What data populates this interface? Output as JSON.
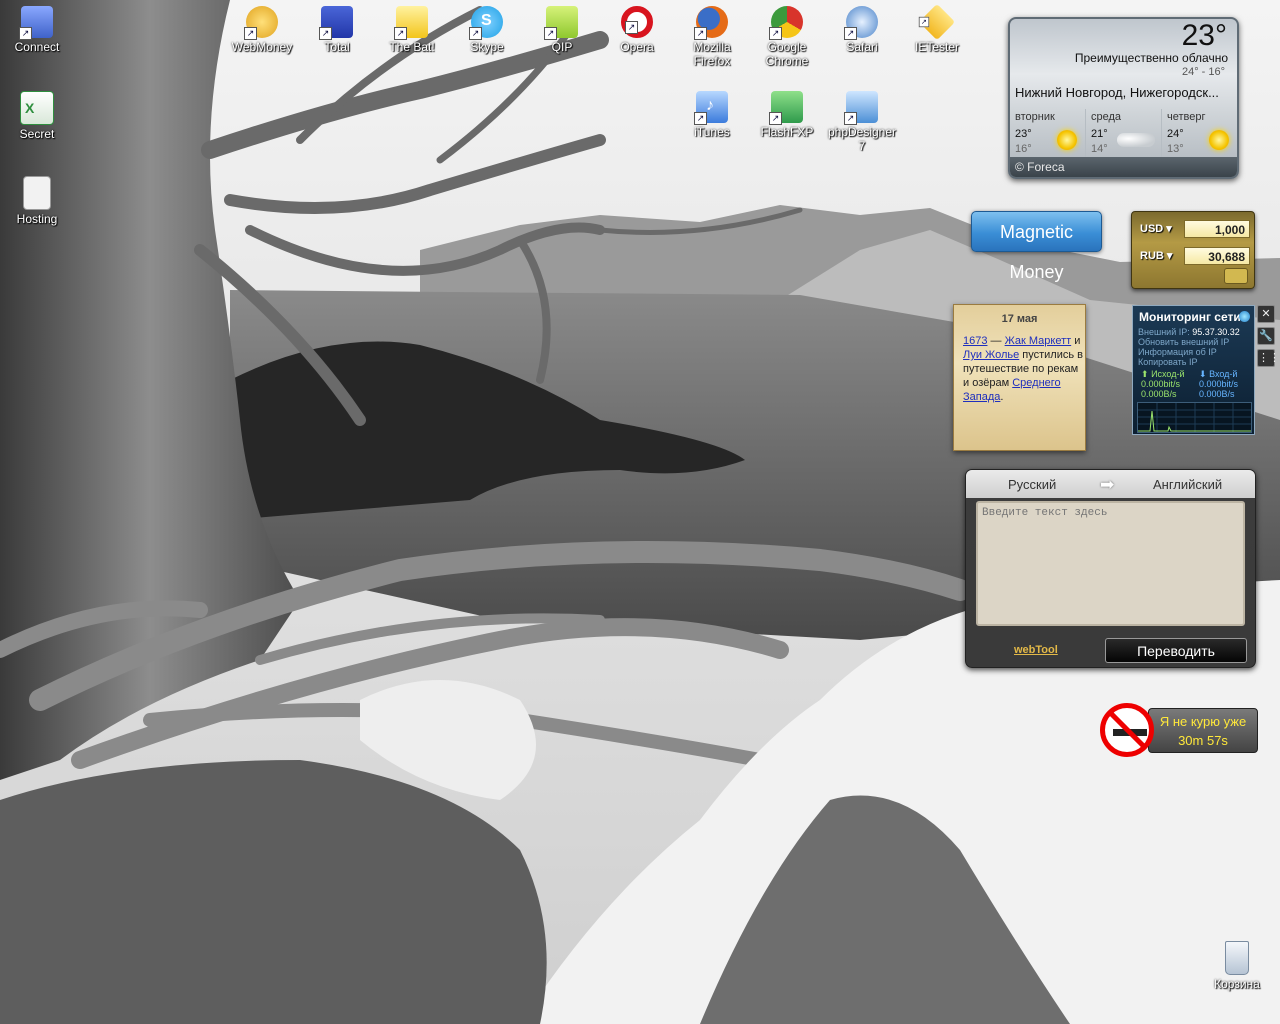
{
  "desktop_icons": [
    {
      "label": "Connect",
      "icon": "network-connection-icon",
      "color": "#3f62c9"
    },
    {
      "label": "Secret",
      "icon": "excel-document-icon",
      "color": "#2f8f3f"
    },
    {
      "label": "Hosting",
      "icon": "document-icon",
      "color": "#e6e6e6"
    },
    {
      "label": "WebMoney",
      "icon": "webmoney-icon",
      "color": "#e0a21d"
    },
    {
      "label": "Total",
      "icon": "total-commander-icon",
      "color": "#2236a8"
    },
    {
      "label": "The Bat!",
      "icon": "the-bat-icon",
      "color": "#f3c51c"
    },
    {
      "label": "Skype",
      "icon": "skype-icon",
      "color": "#1fa1e5"
    },
    {
      "label": "QIP",
      "icon": "qip-icon",
      "color": "#8fc82e"
    },
    {
      "label": "Opera",
      "icon": "opera-icon",
      "color": "#d8141e"
    },
    {
      "label": "Mozilla Firefox",
      "icon": "firefox-icon",
      "color": "#e56b17"
    },
    {
      "label": "Google Chrome",
      "icon": "chrome-icon",
      "color": "#3c9a3c"
    },
    {
      "label": "Safari",
      "icon": "safari-icon",
      "color": "#4a83c9"
    },
    {
      "label": "IETester",
      "icon": "ietester-icon",
      "color": "#f2b722"
    },
    {
      "label": "iTunes",
      "icon": "itunes-icon",
      "color": "#3b7bdc"
    },
    {
      "label": "FlashFXP",
      "icon": "flashfxp-icon",
      "color": "#2e9a4b"
    },
    {
      "label": "phpDesigner 7",
      "icon": "phpdesigner-icon",
      "color": "#4c8fd6"
    },
    {
      "label": "Корзина",
      "icon": "recycle-bin-icon",
      "color": "#cfd8e3"
    }
  ],
  "weather": {
    "temp": "23°",
    "condition": "Преимущественно облачно",
    "range": "24° - 16°",
    "city": "Нижний Новгород, Нижегородск...",
    "days": [
      {
        "name": "вторник",
        "hi": "23°",
        "lo": "16°",
        "icon": "sun-icon"
      },
      {
        "name": "среда",
        "hi": "21°",
        "lo": "14°",
        "icon": "cloud-icon"
      },
      {
        "name": "четверг",
        "hi": "24°",
        "lo": "13°",
        "icon": "sun-icon"
      }
    ],
    "provider": "© Foreca"
  },
  "magnetic_money": {
    "label": "Magnetic Money"
  },
  "currency": {
    "rows": [
      {
        "code": "USD",
        "value": "1,000"
      },
      {
        "code": "RUB",
        "value": "30,688"
      }
    ]
  },
  "history": {
    "date": "17 мая",
    "year": "1673",
    "dash": " — ",
    "person1": "Жак Маркетт",
    "and": " и ",
    "person2": "Луи Жолье",
    "text1": " пустились в путешествие по рекам и озёрам ",
    "place": "Среднего Запада",
    "dot": "."
  },
  "netmon": {
    "title": "Мониторинг сети",
    "ip_label": "Внешний IP: ",
    "ip": "95.37.30.32",
    "refresh": "Обновить внешний IP",
    "info": "Информация об IP",
    "copy": "Копировать IP",
    "out_label": "Исход-й",
    "in_label": "Вход-й",
    "out_bits": "0.000bit/s",
    "out_bytes": "0.000B/s",
    "in_bits": "0.000bit/s",
    "in_bytes": "0.000B/s"
  },
  "netbar": {
    "close": "✕",
    "settings": "🔧",
    "drag": "⋮⋮"
  },
  "translator": {
    "from": "Русский",
    "arrow": "➡",
    "to": "Английский",
    "placeholder": "Введите текст здесь",
    "link": "webTool",
    "button": "Переводить"
  },
  "nosmoke": {
    "line1": "Я не курю уже",
    "line2": "30m 57s"
  }
}
